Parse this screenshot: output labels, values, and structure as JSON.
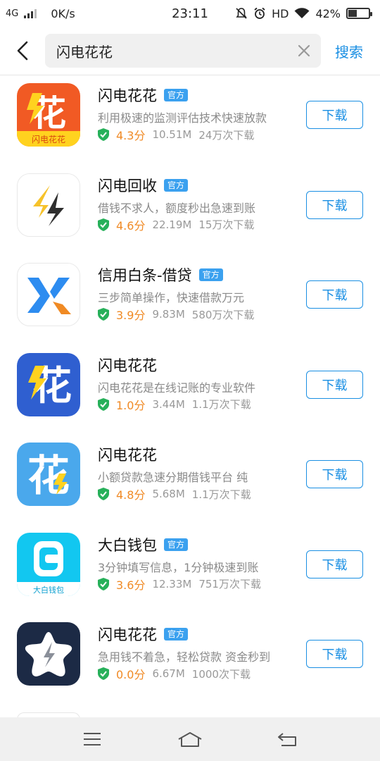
{
  "status_bar": {
    "network": "4G",
    "speed": "0K/s",
    "time": "23:11",
    "hd": "HD",
    "battery": "42%",
    "battery_level": 0.42
  },
  "search": {
    "query": "闪电花花",
    "button_label": "搜索"
  },
  "download_label": "下载",
  "official_label": "官方",
  "apps": [
    {
      "name": "闪电花花",
      "official": true,
      "desc": "利用极速的监测评估技术快速放款",
      "rating": "4.3分",
      "size": "10.51M",
      "downloads": "24万次下载",
      "icon": "lightning-flower-orange",
      "icon_caption": "闪电花花"
    },
    {
      "name": "闪电回收",
      "official": true,
      "desc": "借钱不求人，额度秒出急速到账",
      "rating": "4.6分",
      "size": "22.19M",
      "downloads": "15万次下载",
      "icon": "lightning-bolt-yellow"
    },
    {
      "name": "信用白条-借贷",
      "official": true,
      "desc": "三步简单操作，快速借款万元",
      "rating": "3.9分",
      "size": "9.83M",
      "downloads": "580万次下载",
      "icon": "x-logo-blue-orange"
    },
    {
      "name": "闪电花花",
      "official": false,
      "desc": "闪电花花是在线记账的专业软件",
      "rating": "1.0分",
      "size": "3.44M",
      "downloads": "1.1万次下载",
      "icon": "lightning-flower-blue"
    },
    {
      "name": "闪电花花",
      "official": false,
      "desc": "小额贷款急速分期借钱平台 纯",
      "rating": "4.8分",
      "size": "5.68M",
      "downloads": "1.1万次下载",
      "icon": "flower-lightblue"
    },
    {
      "name": "大白钱包",
      "official": true,
      "desc": "3分钟填写信息，1分钟极速到账",
      "rating": "3.6分",
      "size": "12.33M",
      "downloads": "751万次下载",
      "icon": "wallet-cyan",
      "icon_caption": "大白钱包"
    },
    {
      "name": "闪电花花",
      "official": true,
      "desc": "急用钱不着急，轻松贷款 资金秒到",
      "rating": "0.0分",
      "size": "6.67M",
      "downloads": "1000次下载",
      "icon": "star-bolt-navy"
    }
  ],
  "colors": {
    "accent": "#1a8fe3",
    "rating": "#f08a24",
    "badge": "#3ba1ef",
    "shield": "#27b05a"
  },
  "nav": {
    "menu_icon": "menu-icon",
    "home_icon": "home-icon",
    "back_icon": "back-icon"
  }
}
